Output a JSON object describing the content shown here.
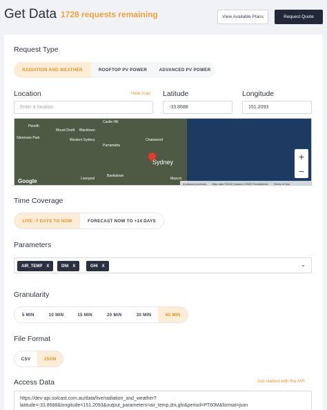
{
  "header": {
    "title": "Get Data",
    "requests": "1728 requests remaining",
    "plans_label": "View Available Plans",
    "quote_label": "Request Quote"
  },
  "request_type": {
    "title": "Request Type",
    "tabs": [
      "RADIATION AND WEATHER",
      "ROOFTOP PV POWER",
      "ADVANCED PV POWER"
    ],
    "active": 0
  },
  "location": {
    "label": "Location",
    "hide_map": "Hide map",
    "placeholder": "Enter a location",
    "latitude_label": "Latitude",
    "latitude": "-33.8688",
    "longitude_label": "Longitude",
    "longitude": "151.2093"
  },
  "map": {
    "city": "Sydney",
    "labels": [
      "Penrith",
      "Mount Druitt",
      "Blacktown",
      "Castle Hill",
      "Chatswood",
      "Parramatta",
      "Bankstown",
      "Liverpool",
      "Mascot",
      "Glenmore Park",
      "Western Sydney"
    ],
    "zoom_in": "+",
    "zoom_out": "−",
    "google": "Google",
    "attribution": [
      "Keyboard shortcuts",
      "Map data ©2022 Imagery ©2022 TerraMetrics",
      "Terms of Use"
    ]
  },
  "time_coverage": {
    "title": "Time Coverage",
    "tabs": [
      "LIVE -7 DAYS TO NOW",
      "FORECAST NOW TO +14 DAYS"
    ],
    "active": 0
  },
  "parameters": {
    "title": "Parameters",
    "chips": [
      "AIR_TEMP",
      "DNI",
      "GHI"
    ],
    "remove": "X"
  },
  "granularity": {
    "title": "Granularity",
    "options": [
      "5 MIN",
      "10 MIN",
      "15 MIN",
      "20 MIN",
      "30 MIN",
      "60 MIN"
    ],
    "active": 5
  },
  "file_format": {
    "title": "File Format",
    "options": [
      "CSV",
      "JSON"
    ],
    "active": 1
  },
  "access": {
    "title": "Access Data",
    "link": "Get started with the API",
    "url_line1": "https://dev-api.solcast.com.au/data/live/radiation_and_weather?",
    "url_line2": "latitude=-33.8688&longitude=151.2093&output_parameters=air_temp,dni,ghi&period=PT60M&format=json"
  },
  "colors": {
    "accent": "#e8952f",
    "active_tab_bg": "#fdecd6",
    "dark": "#232838"
  }
}
